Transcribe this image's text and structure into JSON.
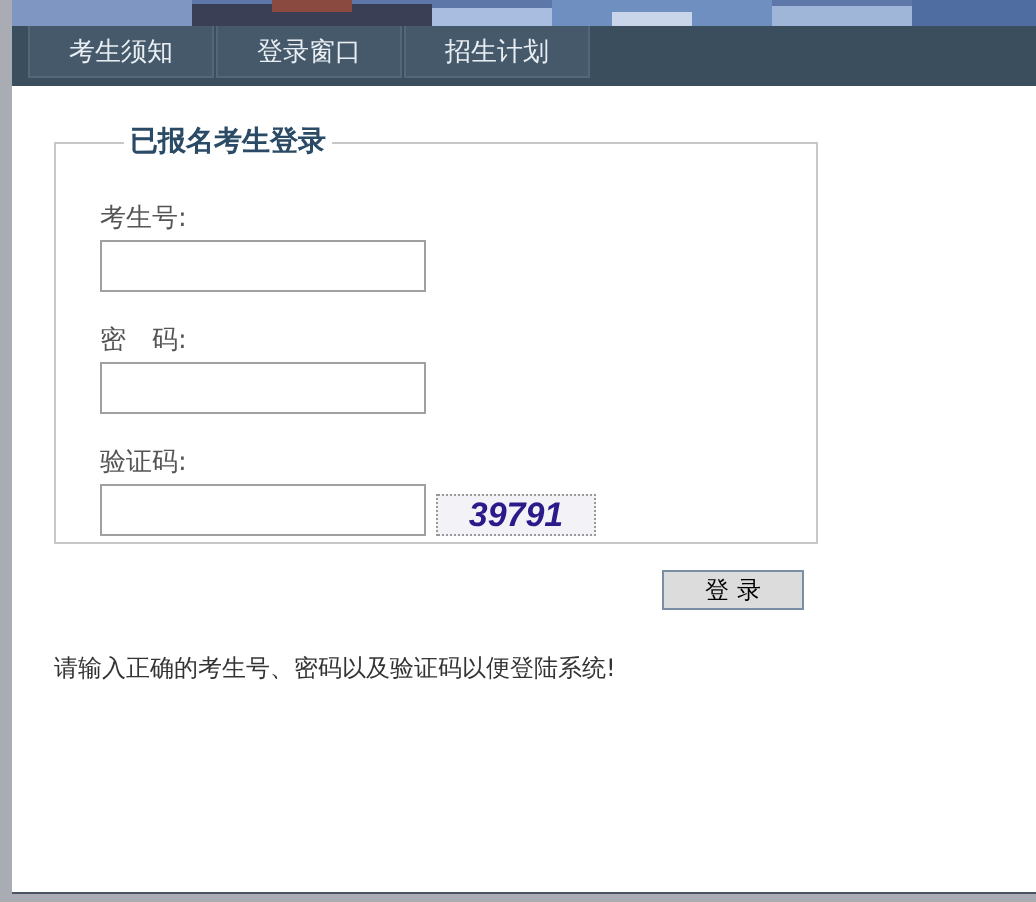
{
  "tabs": [
    {
      "label": "考生须知",
      "selected": false
    },
    {
      "label": "登录窗口",
      "selected": false
    },
    {
      "label": "招生计划",
      "selected": false
    }
  ],
  "login_form": {
    "legend": "已报名考生登录",
    "fields": [
      {
        "label": "考生号:",
        "kind": "text"
      },
      {
        "label": "密　码:",
        "kind": "password"
      },
      {
        "label": "验证码:",
        "kind": "captcha",
        "captcha": "39791"
      }
    ],
    "submit_button": "登 录"
  },
  "message": "请输入正确的考生号、密码以及验证码以便登陆系统!"
}
